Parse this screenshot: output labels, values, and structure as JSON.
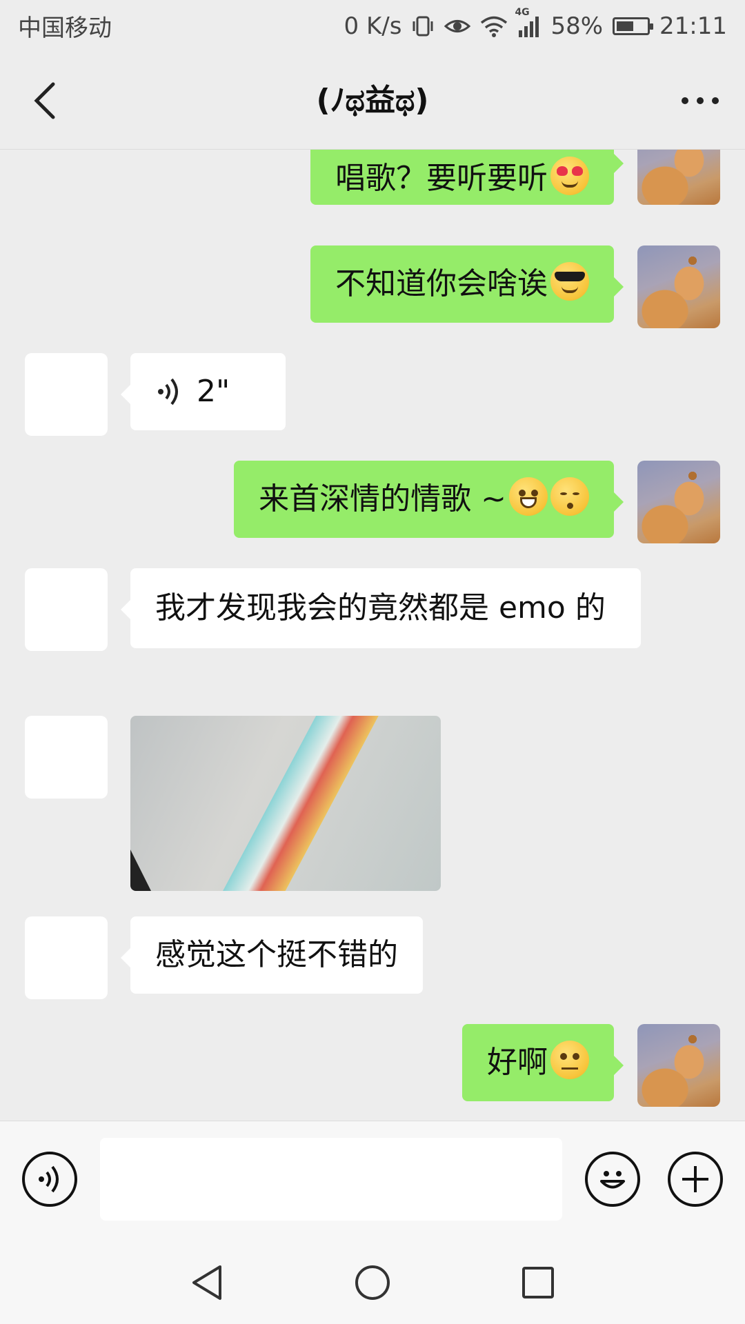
{
  "status_bar": {
    "carrier": "中国移动",
    "net_speed": "0 K/s",
    "network_type": "4G",
    "battery_percent": "58%",
    "battery_level": 0.58,
    "time": "21:11",
    "icons": [
      "vibrate-icon",
      "eye-comfort-icon",
      "wifi-icon",
      "signal-icon",
      "battery-icon"
    ]
  },
  "header": {
    "title": "(ﾉಥ益ಥ)",
    "back_icon": "chevron-left-icon",
    "more_icon": "more-dots-icon"
  },
  "messages": [
    {
      "side": "right",
      "type": "text",
      "text": "唱歌？要听要听",
      "emoji": "heart-eyes-drool-emoji"
    },
    {
      "side": "right",
      "type": "text",
      "text": "不知道你会啥诶",
      "emoji": "sunglasses-emoji"
    },
    {
      "side": "left",
      "type": "voice",
      "duration": "2\""
    },
    {
      "side": "right",
      "type": "text",
      "text": "来首深情的情歌 ~",
      "emoji": "grin-emoji, kissing-emoji"
    },
    {
      "side": "left",
      "type": "text",
      "text": "我才发现我会的竟然都是 emo 的"
    },
    {
      "side": "left",
      "type": "image",
      "image": "photo-of-music-app-screen"
    },
    {
      "side": "left",
      "type": "text",
      "text": "感觉这个挺不错的"
    },
    {
      "side": "right",
      "type": "text",
      "text": "好啊",
      "emoji": "thinking-emoji"
    }
  ],
  "input_bar": {
    "value": "",
    "placeholder": ""
  },
  "colors": {
    "background": "#ededed",
    "outgoing_bubble": "#95ec69",
    "incoming_bubble": "#ffffff"
  }
}
